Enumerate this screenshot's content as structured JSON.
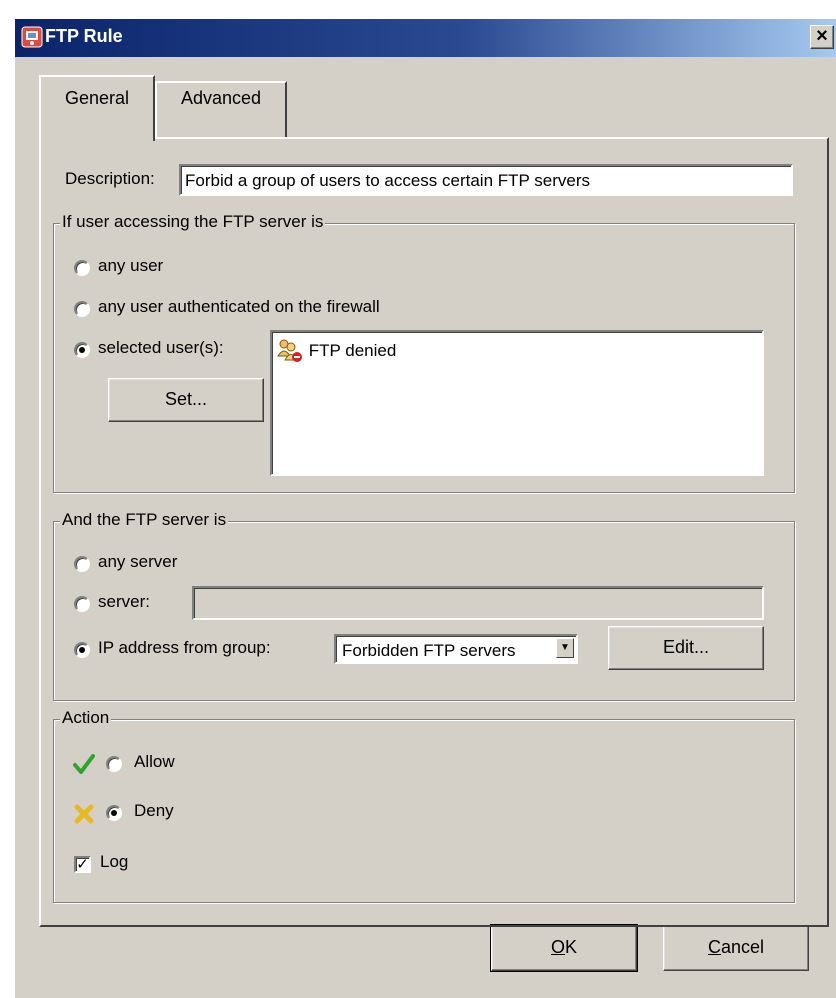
{
  "window": {
    "title": "FTP Rule",
    "close_label": "×"
  },
  "tabs": [
    {
      "label": "General",
      "active": true
    },
    {
      "label": "Advanced",
      "active": false
    }
  ],
  "description": {
    "label": "Description:",
    "value": "Forbid a group of users to access certain FTP servers"
  },
  "user_group": {
    "legend": "If user accessing the FTP server is",
    "options": [
      "any user",
      "any user authenticated on the firewall",
      "selected user(s):"
    ],
    "selected_index": 2,
    "set_button": "Set...",
    "selected_users": [
      {
        "name": "FTP denied",
        "icon": "user-group-denied-icon"
      }
    ]
  },
  "server_group": {
    "legend": "And the FTP server is",
    "options": [
      "any server",
      "server:",
      "IP address from group:"
    ],
    "selected_index": 2,
    "server_value": "",
    "ip_group_value": "Forbidden FTP servers",
    "edit_button": "Edit..."
  },
  "action": {
    "legend": "Action",
    "options": [
      "Allow",
      "Deny"
    ],
    "selected": "Deny",
    "log_label": "Log",
    "log_checked": true
  },
  "footer": {
    "ok_label": "OK",
    "ok_mnemonic": "O",
    "cancel_label": "Cancel",
    "cancel_mnemonic": "C"
  },
  "colors": {
    "face": "#d4d0c8",
    "title_start": "#0a246a",
    "title_end": "#a6caf0",
    "allow": "#2fa52f",
    "deny": "#e8b820"
  }
}
